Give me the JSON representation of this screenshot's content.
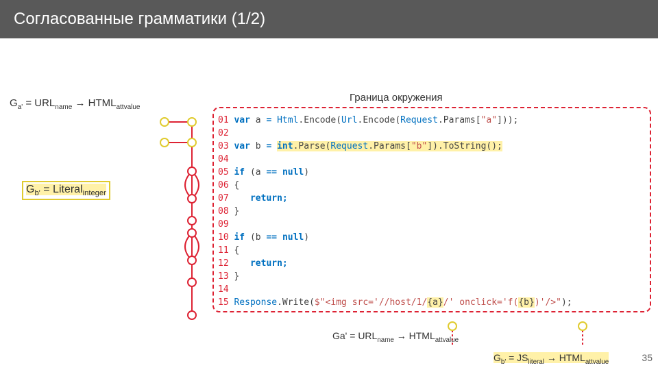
{
  "title": "Согласованные грамматики (1/2)",
  "formula_a": {
    "g": "G",
    "gsub": "a'",
    "eq": " = URL",
    "sub1": "name",
    "arrow": " → HTML",
    "sub2": "attvalue"
  },
  "formula_b": {
    "g": "G",
    "gsub": "b'",
    "eq": " = Literal",
    "sub1": "integer"
  },
  "border_label": "Граница окружения",
  "code": {
    "lines": [
      "01",
      "02",
      "03",
      "04",
      "05",
      "06",
      "07",
      "08",
      "09",
      "10",
      "11",
      "12",
      "13",
      "14",
      "15"
    ],
    "l01_a": "var",
    "l01_b": " a ",
    "l01_c": "=",
    "l01_d": " Html",
    "l01_e": ".Encode(",
    "l01_f": "Url",
    "l01_g": ".Encode(",
    "l01_h": "Request",
    "l01_i": ".Params[",
    "l01_j": "\"a\"",
    "l01_k": "]));",
    "l03_a": "var",
    "l03_b": " b ",
    "l03_c": "=",
    "l03_d": " ",
    "l03_e": "int",
    "l03_f": ".Parse(",
    "l03_g": "Request",
    "l03_h": ".Params[",
    "l03_i": "\"b\"",
    "l03_j": "]).ToString();",
    "l05_a": "if",
    "l05_b": " (a ",
    "l05_c": "==",
    "l05_d": " ",
    "l05_e": "null",
    "l05_f": ")",
    "l06": "{",
    "l07": "   return;",
    "l08": "}",
    "l10_a": "if",
    "l10_b": " (b ",
    "l10_c": "==",
    "l10_d": " ",
    "l10_e": "null",
    "l10_f": ")",
    "l11": "{",
    "l12": "   return;",
    "l13": "}",
    "l15_a": "Response",
    "l15_b": ".Write(",
    "l15_c": "$\"<img src='//host/1/",
    "l15_d": "{a}",
    "l15_e": "/' onclick='f(",
    "l15_f": "{b}",
    "l15_g": ")'/>\"",
    "l15_h": ");"
  },
  "bottom_a": {
    "g": "Ga'",
    "eq": " = URL",
    "sub1": "name",
    "arrow": " → HTML",
    "sub2": "attvalue"
  },
  "bottom_b": {
    "g": "G",
    "gsub": "b'",
    "eq": " = JS",
    "sub1": "literal",
    "arrow": " → HTML",
    "sub2": "attvalue"
  },
  "page_num": "35"
}
